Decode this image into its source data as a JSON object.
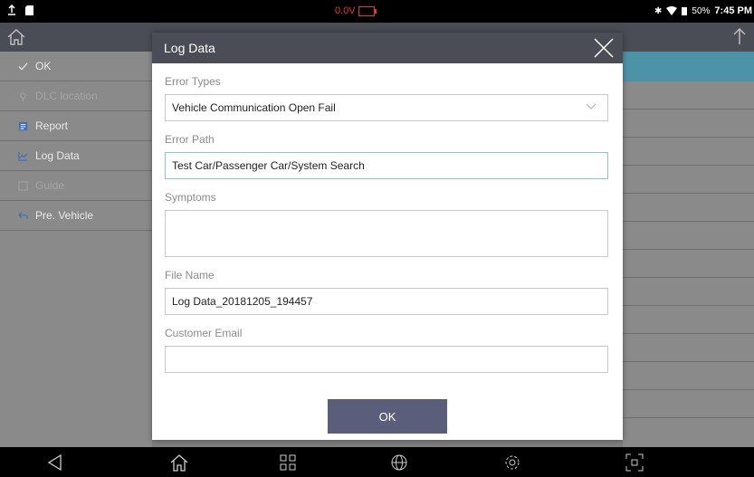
{
  "status_bar": {
    "voltage": "0.0V",
    "battery_percent": "50%",
    "time": "7:45 PM"
  },
  "menu": {
    "items": [
      {
        "label": "OK",
        "icon": "check-icon",
        "enabled": true
      },
      {
        "label": "DLC location",
        "icon": "location-icon",
        "enabled": false
      },
      {
        "label": "Report",
        "icon": "report-icon",
        "enabled": true
      },
      {
        "label": "Log Data",
        "icon": "chart-icon",
        "enabled": true
      },
      {
        "label": "Guide",
        "icon": "guide-icon",
        "enabled": false
      },
      {
        "label": "Pre. Vehicle",
        "icon": "back-arrow-icon",
        "enabled": true
      }
    ]
  },
  "dialog": {
    "title": "Log Data",
    "error_types_label": "Error Types",
    "error_types_value": "Vehicle Communication Open Fail",
    "error_path_label": "Error Path",
    "error_path_value": "Test Car/Passenger Car/System Search",
    "symptoms_label": "Symptoms",
    "symptoms_value": "",
    "file_name_label": "File Name",
    "file_name_value": "Log Data_20181205_194457",
    "customer_email_label": "Customer Email",
    "customer_email_value": "",
    "ok_label": "OK"
  },
  "colors": {
    "header": "#4a4d55",
    "selected_row": "#4d93a8",
    "ok_button": "#5b5e7a",
    "voltage_warning": "#e33333"
  }
}
